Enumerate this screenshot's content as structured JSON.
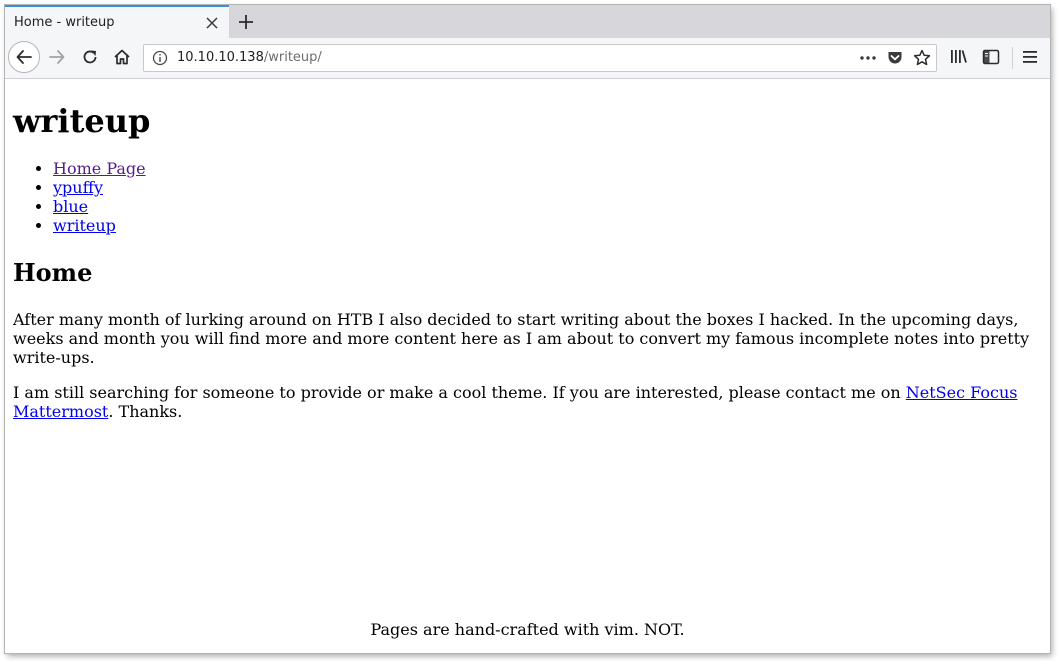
{
  "browser": {
    "tab_title": "Home - writeup",
    "url_host": "10.10.10.138",
    "url_path": "/writeup/",
    "icons": [
      "close-icon",
      "plus-icon",
      "back-arrow-icon",
      "forward-arrow-icon",
      "reload-icon",
      "home-icon",
      "info-icon",
      "more-icon",
      "pocket-icon",
      "star-icon",
      "library-icon",
      "sidebar-icon",
      "hamburger-menu-icon"
    ]
  },
  "page": {
    "title": "writeup",
    "nav": [
      {
        "label": "Home Page",
        "visited": true
      },
      {
        "label": "ypuffy",
        "visited": false
      },
      {
        "label": "blue",
        "visited": false
      },
      {
        "label": "writeup",
        "visited": false
      }
    ],
    "section_title": "Home",
    "paragraph1": "After many month of lurking around on HTB I also decided to start writing about the boxes I hacked. In the upcoming days, weeks and month you will find more and more content here as I am about to convert my famous incomplete notes into pretty write-ups.",
    "paragraph2_before": "I am still searching for someone to provide or make a cool theme. If you are interested, please contact me on ",
    "paragraph2_link": "NetSec Focus Mattermost",
    "paragraph2_after": ". Thanks.",
    "footer": "Pages are hand-crafted with vim. NOT."
  },
  "colors": {
    "link": "#0000ee",
    "visited_link": "#551a8b",
    "tab_accent": "#3a8fd6"
  }
}
